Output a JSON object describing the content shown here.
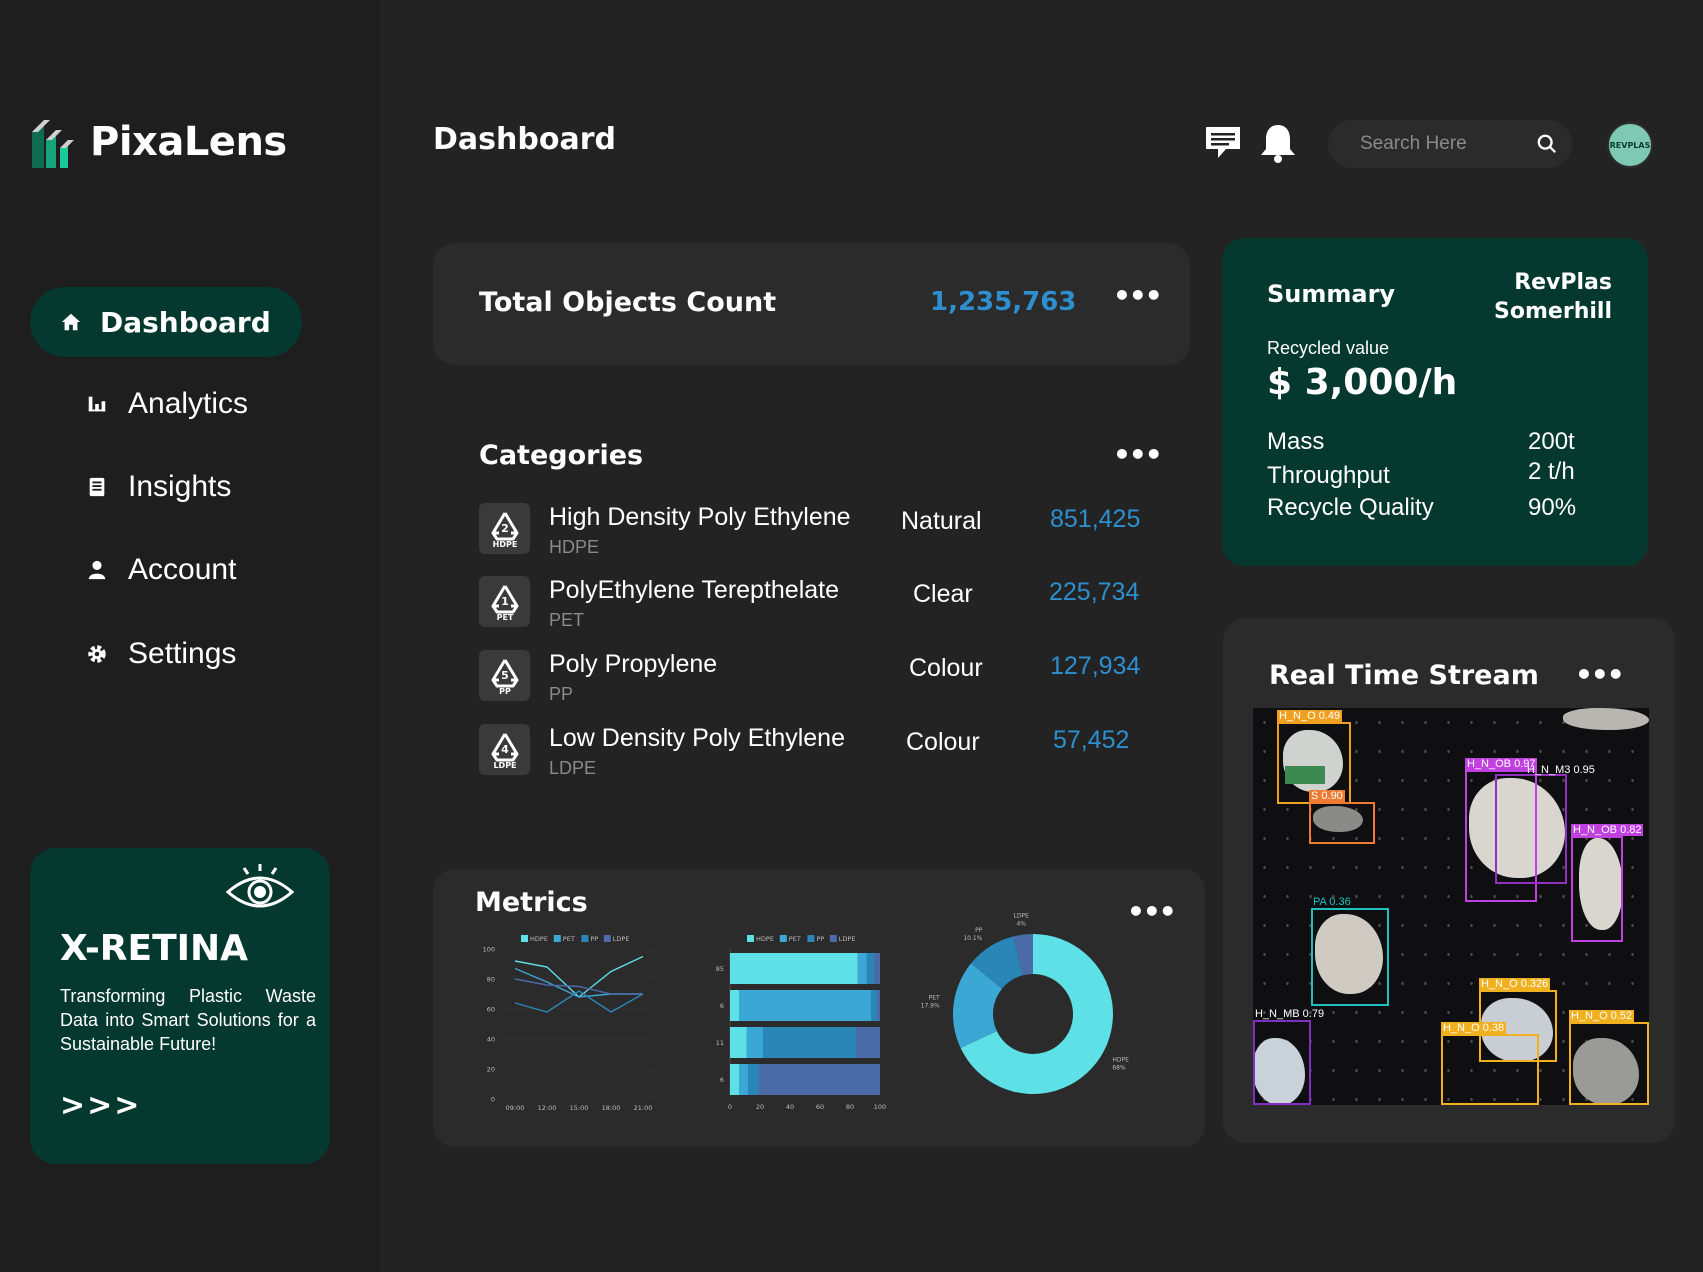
{
  "app": {
    "name": "PixaLens"
  },
  "sidebar": {
    "items": [
      {
        "label": "Dashboard",
        "icon": "home-icon",
        "active": true
      },
      {
        "label": "Analytics",
        "icon": "bar-chart-icon"
      },
      {
        "label": "Insights",
        "icon": "document-icon"
      },
      {
        "label": "Account",
        "icon": "user-icon"
      },
      {
        "label": "Settings",
        "icon": "gear-icon"
      }
    ]
  },
  "promo": {
    "title": "X-RETINA",
    "text": "Transforming Plastic Waste Data into Smart Solutions for a Sustainable Future!",
    "arrows": ">>>"
  },
  "header": {
    "title": "Dashboard",
    "search_placeholder": "Search Here",
    "avatar_text": "REVPLAS"
  },
  "total": {
    "label": "Total Objects Count",
    "value": "1,235,763"
  },
  "categories": {
    "title": "Categories",
    "items": [
      {
        "name": "High Density Poly Ethylene",
        "code": "HDPE",
        "num": "2",
        "type": "Natural",
        "count": "851,425"
      },
      {
        "name": "PolyEthylene Terepthelate",
        "code": "PET",
        "num": "1",
        "type": "Clear",
        "count": "225,734"
      },
      {
        "name": "Poly Propylene",
        "code": "PP",
        "num": "5",
        "type": "Colour",
        "count": "127,934"
      },
      {
        "name": "Low Density Poly Ethylene",
        "code": "LDPE",
        "num": "4",
        "type": "Colour",
        "count": "57,452"
      }
    ]
  },
  "metrics": {
    "title": "Metrics"
  },
  "summary": {
    "title": "Summary",
    "org": "RevPlas Somerhill",
    "recycled_label": "Recycled value",
    "recycled_value": "$ 3,000/h",
    "rows": [
      {
        "label": "Mass",
        "value": "200t"
      },
      {
        "label": "Throughput",
        "value": "2 t/h"
      },
      {
        "label": "Recycle Quality",
        "value": "90%"
      }
    ]
  },
  "stream": {
    "title": "Real Time Stream",
    "detections": [
      {
        "label": "H_N_O 0.49",
        "color": "#f0a020"
      },
      {
        "label": "S 0.90",
        "color": "#f07a30"
      },
      {
        "label": "H_N_OB 0.97",
        "color": "#c040e0"
      },
      {
        "label": "H_N_M3 0.95",
        "color": "#c040e0"
      },
      {
        "label": "H_N_OB 0.82",
        "color": "#c040e0"
      },
      {
        "label": "PA 0.36",
        "color": "#20c0c0"
      },
      {
        "label": "H_N_MB 0.79",
        "color": "#8030c0"
      },
      {
        "label": "H_N_O 0.326",
        "color": "#f0b020"
      },
      {
        "label": "H_N_O 0.38",
        "color": "#f0b020"
      },
      {
        "label": "H_N_O 0.52",
        "color": "#f0b020"
      }
    ]
  },
  "chart_data": [
    {
      "type": "line",
      "legend": [
        "HDPE",
        "PET",
        "PP",
        "LDPE"
      ],
      "x": [
        "09:00",
        "12:00",
        "15:00",
        "18:00",
        "21:00"
      ],
      "ylim": [
        0,
        100
      ],
      "yticks": [
        0,
        20,
        40,
        60,
        80,
        100
      ],
      "series": [
        {
          "name": "HDPE",
          "values": [
            92,
            88,
            68,
            85,
            95
          ]
        },
        {
          "name": "PET",
          "values": [
            87,
            78,
            68,
            70,
            70
          ]
        },
        {
          "name": "PP",
          "values": [
            64,
            58,
            72,
            58,
            70
          ]
        },
        {
          "name": "LDPE",
          "values": [
            80,
            76,
            75,
            70,
            70
          ]
        }
      ],
      "colors": [
        "#5de0e6",
        "#3aa7d4",
        "#2b86b8",
        "#4a6aa8"
      ]
    },
    {
      "type": "bar",
      "orientation": "horizontal",
      "stacked": true,
      "legend": [
        "HDPE",
        "PET",
        "PP",
        "LDPE"
      ],
      "categories": [
        "85",
        "6",
        "11",
        "6"
      ],
      "xticks": [
        0,
        20,
        40,
        60,
        80,
        100
      ],
      "series": [
        {
          "name": "HDPE",
          "values": [
            85,
            6,
            11,
            6
          ]
        },
        {
          "name": "PET",
          "values": [
            6,
            88,
            11,
            6
          ]
        },
        {
          "name": "PP",
          "values": [
            5,
            4,
            62,
            7
          ]
        },
        {
          "name": "LDPE",
          "values": [
            4,
            2,
            16,
            81
          ]
        }
      ],
      "colors": [
        "#5de0e6",
        "#3aa7d4",
        "#2b86b8",
        "#4a6aa8"
      ]
    },
    {
      "type": "pie",
      "donut": true,
      "slices": [
        {
          "name": "HDPE",
          "pct_label": "68%",
          "value": 68,
          "color": "#5de0e6"
        },
        {
          "name": "PET",
          "pct_label": "17.9%",
          "value": 17.9,
          "color": "#3aa7d4"
        },
        {
          "name": "PP",
          "pct_label": "10.1%",
          "value": 10.1,
          "color": "#2b86b8"
        },
        {
          "name": "LDPE",
          "pct_label": "4%",
          "value": 4,
          "color": "#4a6aa8"
        }
      ]
    }
  ]
}
